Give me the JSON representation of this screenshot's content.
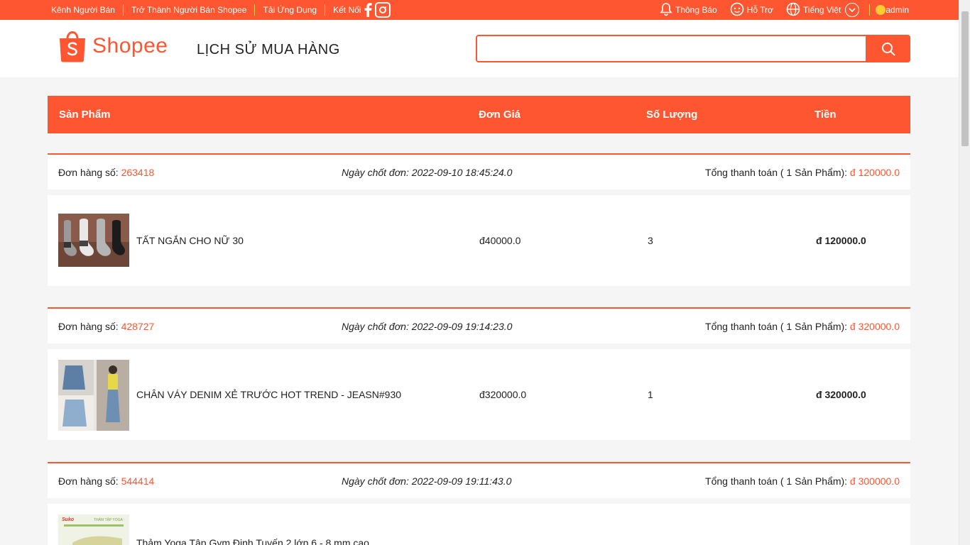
{
  "topbar": {
    "left_items": [
      "Kênh Người Bán",
      "Trở Thành Người Bán Shopee",
      "Tải Ứng Dụng",
      "Kết Nối"
    ],
    "notifications": "Thông Báo",
    "support": "Hỗ Trợ",
    "language": "Tiếng Việt",
    "user": "admin"
  },
  "header": {
    "logo_text": "Shopee",
    "page_title": "LỊCH SỬ MUA HÀNG",
    "search_value": "",
    "search_placeholder": ""
  },
  "table": {
    "col_product": "Sản Phẩm",
    "col_unit_price": "Đơn Giá",
    "col_quantity": "Số Lượng",
    "col_amount": "Tiền"
  },
  "orders": [
    {
      "order_label": "Đơn hàng số: ",
      "order_id": "263418",
      "date_text": "Ngày chốt đơn: 2022-09-10 18:45:24.0",
      "total_label": "Tổng thanh toán ( 1 Sản Phẩm): ",
      "total_value": "đ 120000.0",
      "product": "TẤT NGẮN CHO NỮ 30",
      "unit_price": "đ40000.0",
      "quantity": "3",
      "amount": "đ 120000.0"
    },
    {
      "order_label": "Đơn hàng số: ",
      "order_id": "428727",
      "date_text": "Ngày chốt đơn: 2022-09-09 19:14:23.0",
      "total_label": "Tổng thanh toán ( 1 Sản Phẩm): ",
      "total_value": "đ 320000.0",
      "product": "CHÂN VÁY DENIM XẺ TRƯỚC HOT TREND - JEASN#930",
      "unit_price": "đ320000.0",
      "quantity": "1",
      "amount": "đ 320000.0"
    },
    {
      "order_label": "Đơn hàng số: ",
      "order_id": "544414",
      "date_text": "Ngày chốt đơn: 2022-09-09 19:11:43.0",
      "total_label": "Tổng thanh toán ( 1 Sản Phẩm): ",
      "total_value": "đ 300000.0",
      "product": "Thảm Yoga Tập Gym Định Tuyến 2 lớp 6 - 8 mm cao",
      "thumb_text": "THẢM TẬP YOGA"
    }
  ],
  "colors": {
    "brand": "#fe5630",
    "divider": "#ffd24d"
  }
}
